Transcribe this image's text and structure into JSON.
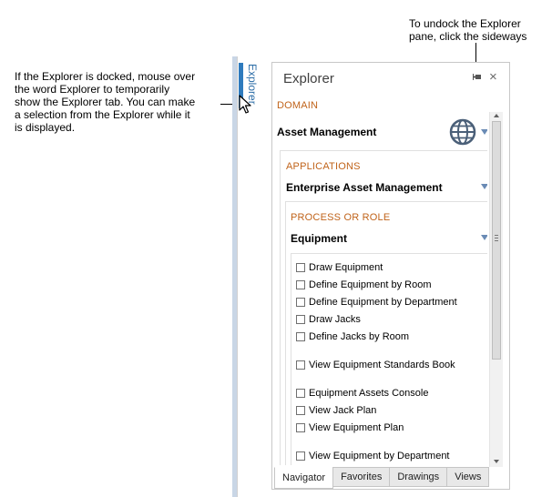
{
  "callouts": {
    "left_lines": [
      "If the Explorer is docked, mouse over",
      "the word Explorer to temporarily",
      "show the Explorer tab. You can make",
      "a selection from the Explorer while it",
      "is displayed."
    ],
    "top_lines": [
      "To undock the Explorer",
      "pane, click the sideways"
    ]
  },
  "dock_tab": {
    "label": "Explorer"
  },
  "pane": {
    "title": "Explorer",
    "pin_icon": "pin-sideways-icon",
    "close_icon": "close-icon",
    "close_glyph": "×"
  },
  "domain": {
    "label": "DOMAIN",
    "value": "Asset Management",
    "icon": "globe-icon"
  },
  "applications": {
    "label": "APPLICATIONS",
    "value": "Enterprise Asset Management"
  },
  "process": {
    "label": "PROCESS OR ROLE",
    "value": "Equipment"
  },
  "tasks": [
    "Draw Equipment",
    "Define Equipment by Room",
    "Define Equipment by Department",
    "Draw Jacks",
    "Define Jacks by Room",
    "View Equipment Standards Book",
    "Equipment Assets Console",
    "View Jack Plan",
    "View Equipment Plan",
    "View Equipment by Department"
  ],
  "tabs": [
    {
      "label": "Navigator",
      "active": true
    },
    {
      "label": "Favorites",
      "active": false
    },
    {
      "label": "Drawings",
      "active": false
    },
    {
      "label": "Views",
      "active": false
    }
  ],
  "colors": {
    "accent": "#2f7bbd",
    "section_label": "#c0631a",
    "dropdown_arrow": "#6a8bb5"
  }
}
